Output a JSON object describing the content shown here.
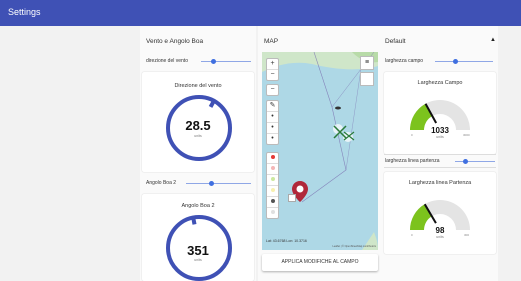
{
  "app": {
    "title": "Settings"
  },
  "left": {
    "title": "Vento e Angolo Boa",
    "wind_slider_label": "direzione del vento",
    "wind_gauge": {
      "title": "Direzione del vento",
      "value": "28.5",
      "unit": "units",
      "fraction": 0.08
    },
    "boa_slider_label": "Angolo Boa 2",
    "boa_gauge": {
      "title": "Angolo Boa 2",
      "value": "351",
      "unit": "units",
      "fraction": 0.97
    }
  },
  "middle": {
    "title": "MAP",
    "map_controls": {
      "zoom_in": "+",
      "zoom_out": "−",
      "minus": "−",
      "edit": "✎",
      "layers": "≡"
    },
    "coords": "Lat: 43.6768  Lon: 10.3716",
    "attribution": "Leaflet | © OpenStreetMap contributors",
    "apply_button": "APPLICA MODIFICHE AL CAMPO",
    "palette": [
      "#e53935",
      "#f4b6b6",
      "#cce8a0",
      "#f7f0b0",
      "#555555",
      "#e0e0e0"
    ]
  },
  "right": {
    "title": "Default",
    "campo_slider_label": "larghezza campo",
    "campo_gauge": {
      "title": "Larghezza Campo",
      "value": "1033",
      "unit": "units",
      "min": "0",
      "max": "3000",
      "fraction": 0.34
    },
    "partenza_slider_label": "larghezza linea partenza",
    "partenza_gauge": {
      "title": "Larghezza linea Partenza",
      "value": "98",
      "unit": "units",
      "min": "0",
      "max": "300",
      "fraction": 0.33
    }
  },
  "colors": {
    "primary": "#3f51b5",
    "gauge_fill": "#7cc31d",
    "gauge_empty": "#e4e4e4",
    "ring": "#3f51b5"
  }
}
